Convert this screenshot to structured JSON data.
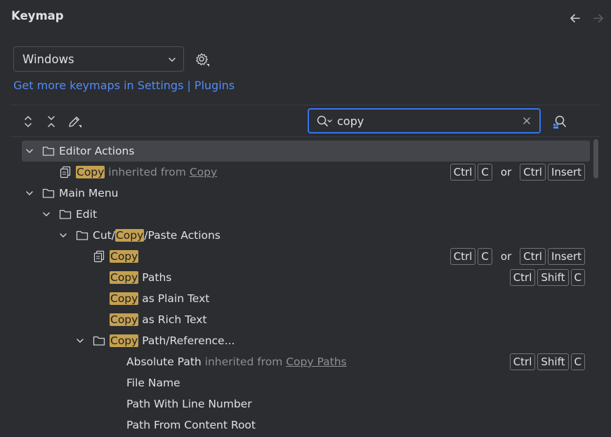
{
  "header": {
    "title": "Keymap",
    "back_icon": "arrow-left-icon",
    "forward_icon": "arrow-right-icon"
  },
  "keymap_select": {
    "value": "Windows"
  },
  "links": {
    "get_more": "Get more keymaps in Settings",
    "separator": "|",
    "plugins": "Plugins"
  },
  "search": {
    "value": "copy"
  },
  "colors": {
    "accent": "#3574f0",
    "link": "#548af7",
    "highlight": "#c4a050",
    "background": "#2b2d30",
    "selected_row": "#43454a"
  },
  "tree": {
    "or_label": "or",
    "rows": [
      {
        "type": "group",
        "hl": "",
        "post": "Editor Actions"
      },
      {
        "type": "action",
        "hl": "Copy",
        "post": "",
        "inherited": "inherited from",
        "inherited_ref": "Copy",
        "shortcut1": [
          "Ctrl",
          "C"
        ],
        "shortcut2": [
          "Ctrl",
          "Insert"
        ]
      },
      {
        "type": "group",
        "hl": "",
        "post": "Main Menu"
      },
      {
        "type": "group",
        "hl": "",
        "post": "Edit"
      },
      {
        "type": "group",
        "pre": "Cut/",
        "hl": "Copy",
        "post": "/Paste Actions"
      },
      {
        "type": "action",
        "hl": "Copy",
        "post": "",
        "shortcut1": [
          "Ctrl",
          "C"
        ],
        "shortcut2": [
          "Ctrl",
          "Insert"
        ]
      },
      {
        "type": "action",
        "hl": "Copy",
        "post": " Paths",
        "shortcut1": [
          "Ctrl",
          "Shift",
          "C"
        ]
      },
      {
        "type": "action",
        "hl": "Copy",
        "post": " as Plain Text"
      },
      {
        "type": "action",
        "hl": "Copy",
        "post": " as Rich Text"
      },
      {
        "type": "group",
        "hl": "Copy",
        "post": " Path/Reference..."
      },
      {
        "type": "action",
        "hl": "",
        "post": "Absolute Path",
        "inherited": "inherited from",
        "inherited_ref": "Copy Paths",
        "shortcut1": [
          "Ctrl",
          "Shift",
          "C"
        ]
      },
      {
        "type": "action",
        "hl": "",
        "post": "File Name"
      },
      {
        "type": "action",
        "hl": "",
        "post": "Path With Line Number"
      },
      {
        "type": "action",
        "hl": "",
        "post": "Path From Content Root"
      }
    ]
  }
}
